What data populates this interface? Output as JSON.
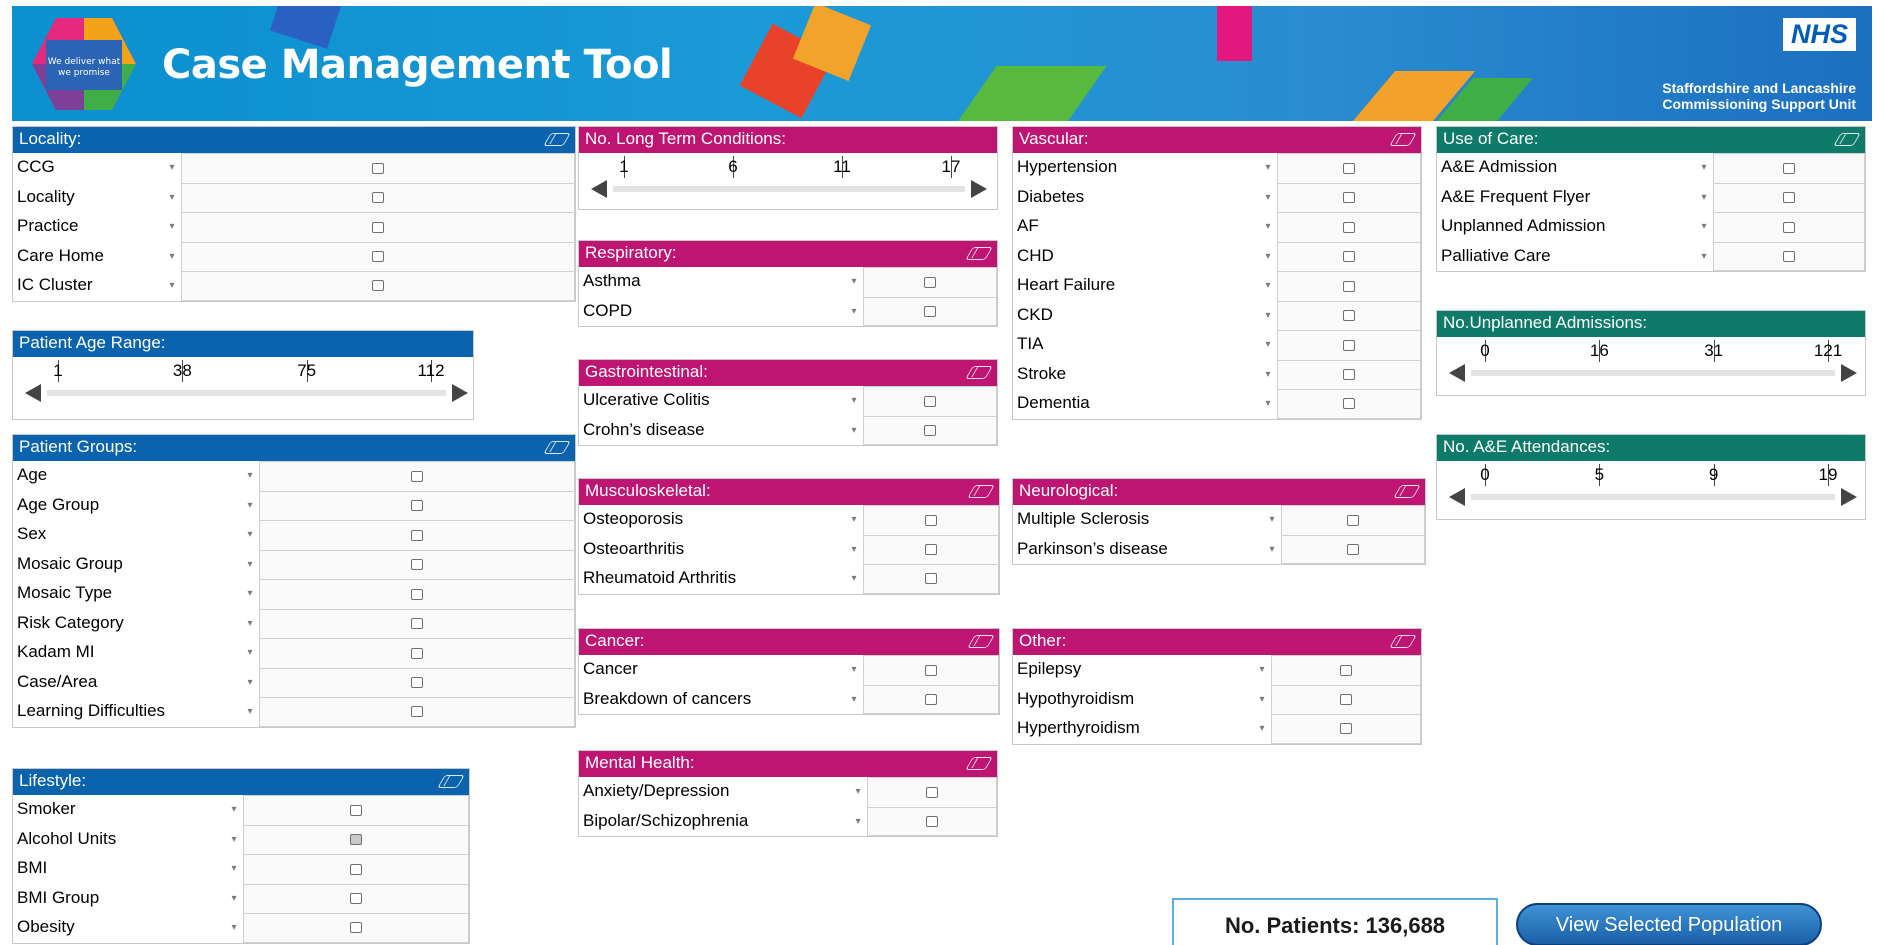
{
  "banner": {
    "logo_text": "We deliver what we promise",
    "title": "Case Management Tool",
    "nhs": "NHS",
    "org": "Staffordshire and Lancashire\nCommissioning Support Unit"
  },
  "colors": {
    "blue": "#0a63ac",
    "magenta": "#be1472",
    "teal": "#0e7b6a"
  },
  "panels": {
    "locality": {
      "title": "Locality:",
      "items": [
        "CCG",
        "Locality",
        "Practice",
        "Care Home",
        "IC Cluster"
      ]
    },
    "age_range": {
      "title": "Patient Age Range:",
      "ticks": [
        "1",
        "38",
        "75",
        "112"
      ]
    },
    "patient_groups": {
      "title": "Patient Groups:",
      "items": [
        "Age",
        "Age Group",
        "Sex",
        "Mosaic Group",
        "Mosaic Type",
        "Risk Category",
        "Kadam MI",
        "Case/Area",
        "Learning Difficulties"
      ]
    },
    "lifestyle": {
      "title": "Lifestyle:",
      "items": [
        "Smoker",
        "Alcohol Units",
        "BMI",
        "BMI Group",
        "Obesity"
      ],
      "partial_index": 1
    },
    "ltc": {
      "title": "No. Long Term Conditions:",
      "ticks": [
        "1",
        "6",
        "11",
        "17"
      ]
    },
    "respiratory": {
      "title": "Respiratory:",
      "items": [
        "Asthma",
        "COPD"
      ]
    },
    "gastro": {
      "title": "Gastrointestinal:",
      "items": [
        "Ulcerative Colitis",
        "Crohn’s disease"
      ]
    },
    "musculo": {
      "title": "Musculoskeletal:",
      "items": [
        "Osteoporosis",
        "Osteoarthritis",
        "Rheumatoid Arthritis"
      ]
    },
    "cancer": {
      "title": "Cancer:",
      "items": [
        "Cancer",
        "Breakdown of cancers"
      ]
    },
    "mental": {
      "title": "Mental Health:",
      "items": [
        "Anxiety/Depression",
        "Bipolar/Schizophrenia"
      ]
    },
    "vascular": {
      "title": "Vascular:",
      "items": [
        "Hypertension",
        "Diabetes",
        "AF",
        "CHD",
        "Heart Failure",
        "CKD",
        "TIA",
        "Stroke",
        "Dementia"
      ]
    },
    "neuro": {
      "title": "Neurological:",
      "items": [
        "Multiple Sclerosis",
        "Parkinson’s disease"
      ]
    },
    "other": {
      "title": "Other:",
      "items": [
        "Epilepsy",
        "Hypothyroidism",
        "Hyperthyroidism"
      ]
    },
    "use_of_care": {
      "title": "Use of Care:",
      "items": [
        "A&E Admission",
        "A&E Frequent Flyer",
        "Unplanned Admission",
        "Palliative Care"
      ]
    },
    "unplanned": {
      "title": "No.Unplanned Admissions:",
      "ticks": [
        "0",
        "16",
        "31",
        "121"
      ]
    },
    "ae_att": {
      "title": "No. A&E Attendances:",
      "ticks": [
        "0",
        "5",
        "9",
        "19"
      ]
    }
  },
  "footer": {
    "patients": "No. Patients: 136,688",
    "button": "View Selected Population"
  }
}
